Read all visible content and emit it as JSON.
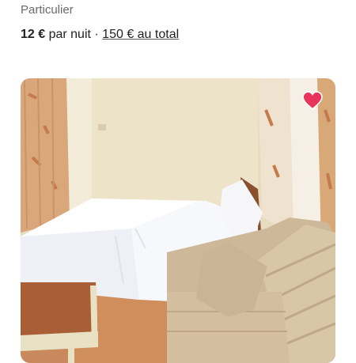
{
  "listing": {
    "host_type": "Particulier",
    "price_amount": "12 €",
    "price_unit": " par nuit",
    "separator": " · ",
    "total_label": "150 € au total"
  },
  "photo": {
    "favorite_icon": "heart-icon",
    "favorite_color": "#e8335a",
    "subject": "bedroom-photo"
  },
  "colors": {
    "text_primary": "#222222",
    "text_secondary": "#6a6a6a"
  }
}
